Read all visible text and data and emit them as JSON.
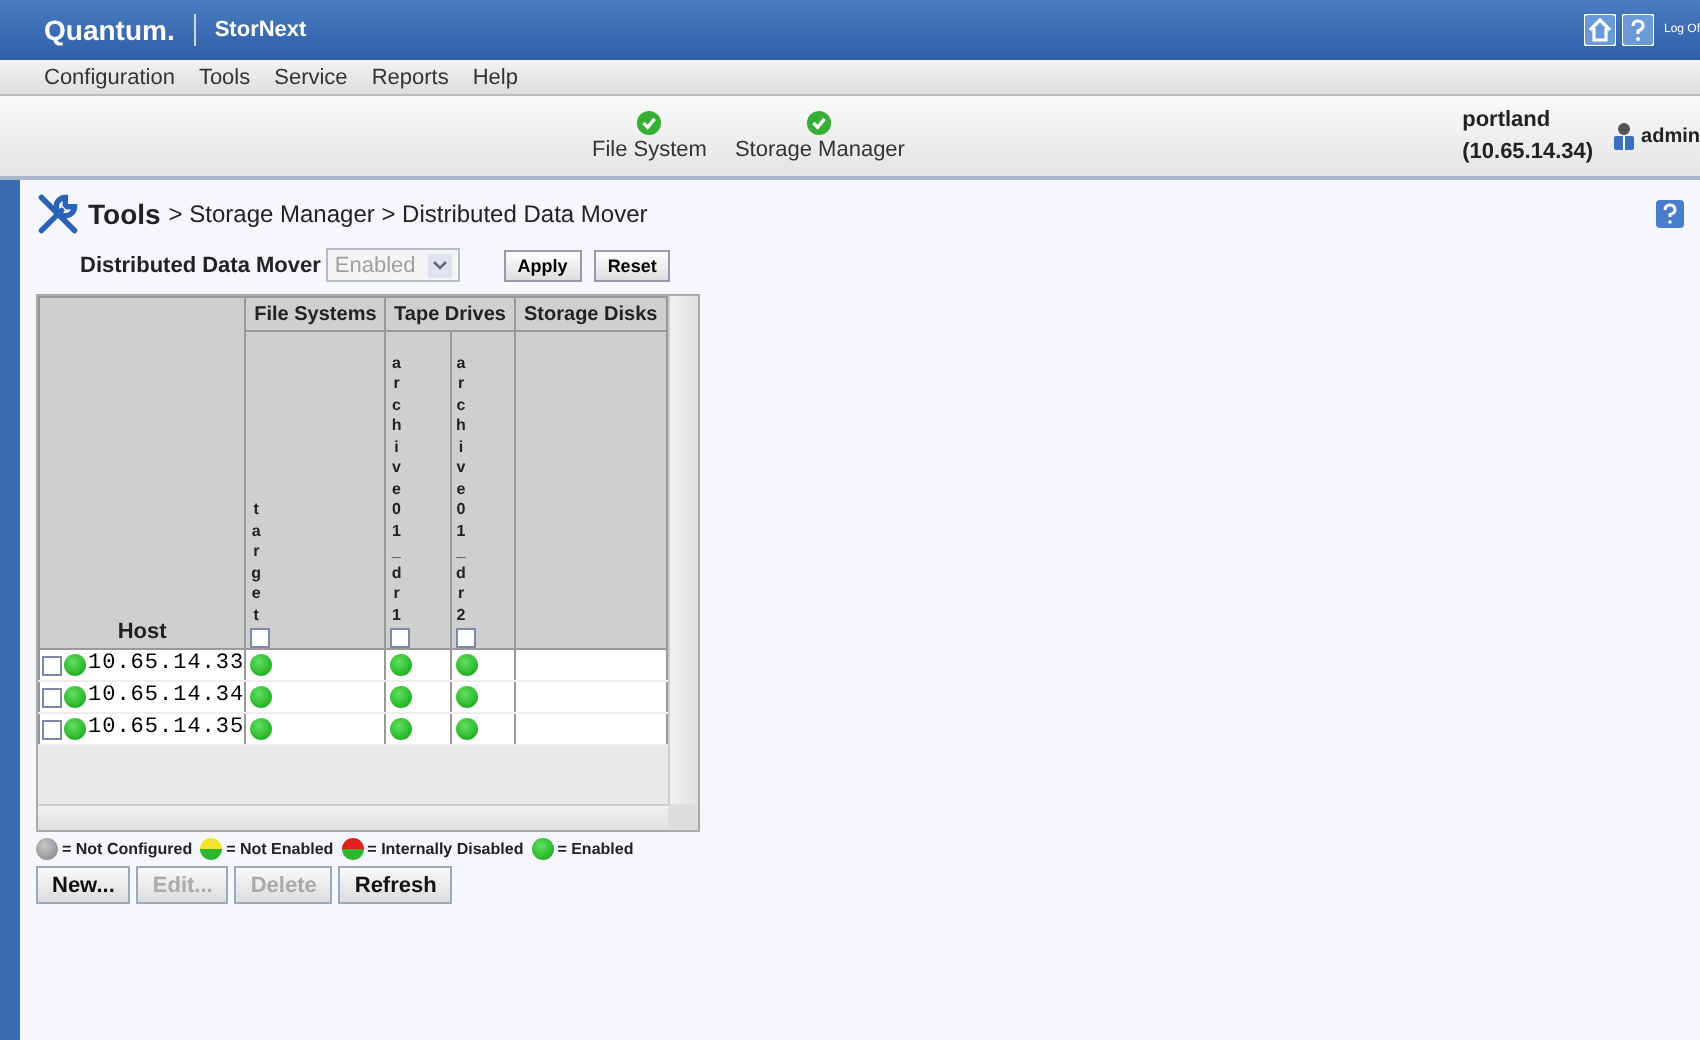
{
  "header": {
    "logo": "Quantum.",
    "product": "StorNext",
    "logout": "Log Of"
  },
  "menu": [
    "Configuration",
    "Tools",
    "Service",
    "Reports",
    "Help"
  ],
  "services": [
    {
      "label": "File System",
      "kind": "ok"
    },
    {
      "label": "Storage Manager",
      "kind": "ok"
    }
  ],
  "system": {
    "name": "portland",
    "address": "(10.65.14.34)",
    "user": "admin"
  },
  "breadcrumb": {
    "root": "Tools",
    "path": "> Storage Manager > Distributed Data Mover"
  },
  "setting": {
    "label": "Distributed Data Mover",
    "value": "Enabled",
    "disabled": true,
    "buttons": [
      "Apply",
      "Reset"
    ]
  },
  "table": {
    "host_header": "Host",
    "groups": [
      {
        "label": "File Systems",
        "columns": [
          {
            "label": "target",
            "checked": false
          }
        ]
      },
      {
        "label": "Tape Drives",
        "columns": [
          {
            "label": "archive01_dr1",
            "checked": false
          },
          {
            "label": "archive01_dr2",
            "checked": false
          }
        ]
      },
      {
        "label": "Storage Disks"
      }
    ],
    "rows": [
      {
        "host": "10.65.14.33",
        "checked": false,
        "kind": "enabled",
        "cells": [
          {
            "kind": "enabled"
          },
          {
            "kind": "enabled"
          },
          {
            "kind": "enabled"
          }
        ]
      },
      {
        "host": "10.65.14.34",
        "checked": false,
        "kind": "enabled",
        "cells": [
          {
            "kind": "enabled"
          },
          {
            "kind": "enabled"
          },
          {
            "kind": "enabled"
          }
        ]
      },
      {
        "host": "10.65.14.35",
        "checked": false,
        "kind": "enabled",
        "cells": [
          {
            "kind": "enabled"
          },
          {
            "kind": "enabled"
          },
          {
            "kind": "enabled"
          }
        ]
      }
    ]
  },
  "legend": [
    {
      "kind": "not_configured",
      "label": "= Not Configured"
    },
    {
      "kind": "not_enabled",
      "label": "= Not Enabled"
    },
    {
      "kind": "internally_disabled",
      "label": "= Internally Disabled"
    },
    {
      "kind": "enabled",
      "label": "= Enabled"
    }
  ],
  "actions": [
    {
      "label": "New...",
      "disabled": false
    },
    {
      "label": "Edit...",
      "disabled": true
    },
    {
      "label": "Delete",
      "disabled": true
    },
    {
      "label": "Refresh",
      "disabled": false
    }
  ]
}
